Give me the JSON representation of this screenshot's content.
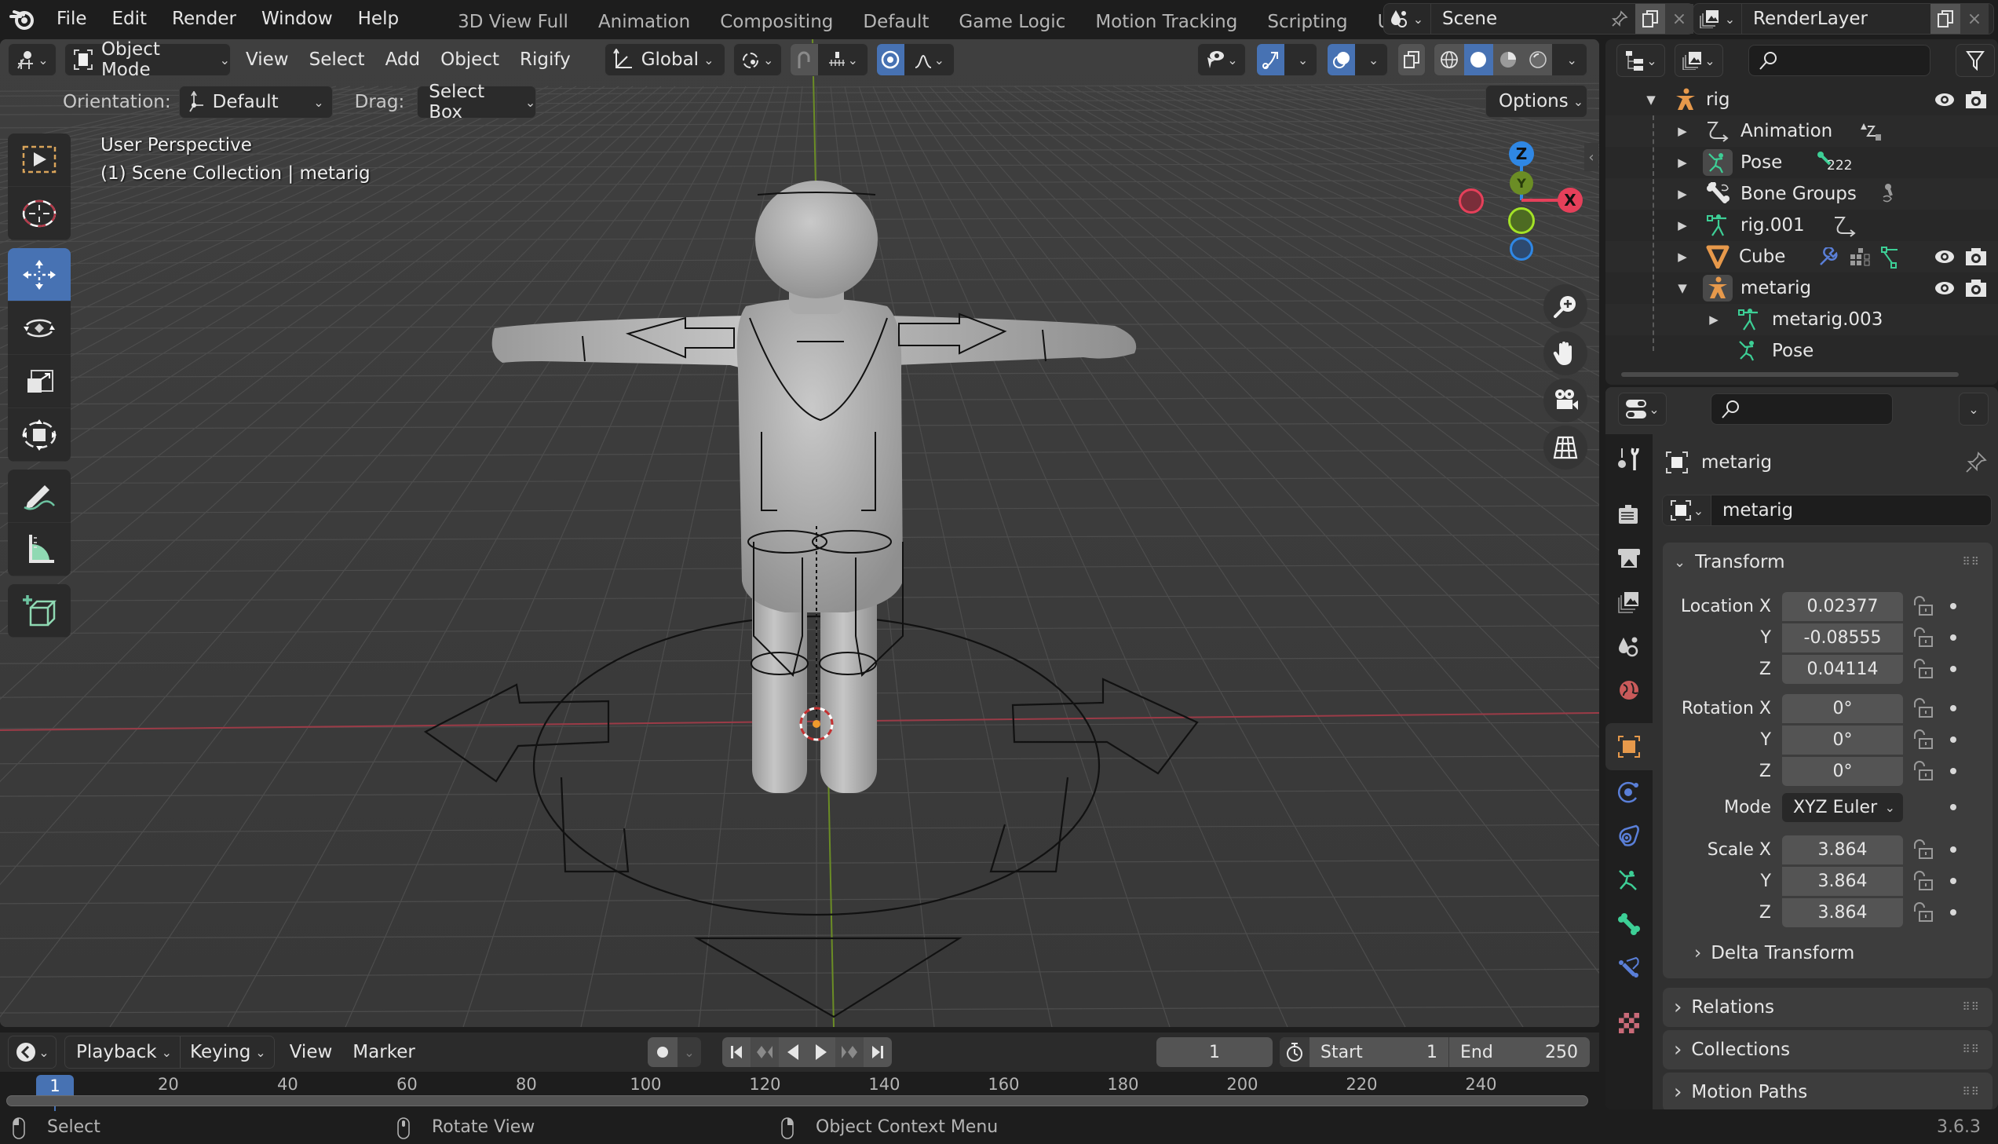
{
  "app": {
    "menus": [
      "File",
      "Edit",
      "Render",
      "Window",
      "Help"
    ],
    "workspaces": [
      "3D View Full",
      "Animation",
      "Compositing",
      "Default",
      "Game Logic",
      "Motion Tracking",
      "Scripting",
      "UV Editi"
    ],
    "scene": "Scene",
    "view_layer": "RenderLayer",
    "version": "3.6.3"
  },
  "viewport": {
    "mode": "Object Mode",
    "menus": [
      "View",
      "Select",
      "Add",
      "Object",
      "Rigify"
    ],
    "transform_orientation": "Global",
    "orientation_label": "Orientation:",
    "orientation_value": "Default",
    "drag_label": "Drag:",
    "drag_value": "Select Box",
    "options_label": "Options",
    "overlay_line1": "User Perspective",
    "overlay_line2": "(1) Scene Collection | metarig",
    "gizmo": {
      "x": "X",
      "y": "Y",
      "z": "Z"
    },
    "colors": {
      "x": "#e5405a",
      "y": "#8bc32a",
      "z": "#2f87e4",
      "accent": "#4772b3"
    }
  },
  "toolbar": {
    "tools": [
      "select-box",
      "cursor",
      "move",
      "rotate",
      "scale",
      "transform",
      "annotate",
      "measure",
      "add-cube"
    ],
    "active": "move"
  },
  "timeline": {
    "menus": [
      "Playback",
      "Keying",
      "View",
      "Marker"
    ],
    "current_frame": "1",
    "start_label": "Start",
    "start": "1",
    "end_label": "End",
    "end": "250",
    "ticks": [
      "20",
      "40",
      "60",
      "80",
      "100",
      "120",
      "140",
      "160",
      "180",
      "200",
      "220",
      "240"
    ],
    "playhead": "1"
  },
  "statusbar": {
    "left": "Select",
    "middle": "Rotate View",
    "right": "Object Context Menu"
  },
  "outliner": {
    "rows": [
      {
        "label": "rig",
        "depth": 0,
        "expanded": true,
        "icon": "armature-icon"
      },
      {
        "label": "Animation",
        "depth": 1,
        "icon": "animation-icon"
      },
      {
        "label": "Pose",
        "depth": 1,
        "icon": "pose-icon",
        "badge": "222"
      },
      {
        "label": "Bone Groups",
        "depth": 1,
        "icon": "bone-groups-icon"
      },
      {
        "label": "rig.001",
        "depth": 1,
        "icon": "armature-data-icon"
      },
      {
        "label": "Cube",
        "depth": 1,
        "icon": "mesh-icon"
      },
      {
        "label": "metarig",
        "depth": 1,
        "expanded": true,
        "icon": "armature-icon"
      },
      {
        "label": "metarig.003",
        "depth": 2,
        "icon": "armature-data-icon"
      },
      {
        "label": "Pose",
        "depth": 2,
        "icon": "pose-icon"
      }
    ]
  },
  "properties": {
    "object_name": "metarig",
    "datablock_name": "metarig",
    "transform": {
      "title": "Transform",
      "location_label": "Location X",
      "location": [
        "0.02377",
        "-0.08555",
        "0.04114"
      ],
      "rotation_label": "Rotation X",
      "rotation": [
        "0°",
        "0°",
        "0°"
      ],
      "mode_label": "Mode",
      "mode": "XYZ Euler",
      "scale_label": "Scale X",
      "scale": [
        "3.864",
        "3.864",
        "3.864"
      ],
      "axis_y": "Y",
      "axis_z": "Z",
      "delta": "Delta Transform"
    },
    "panels": [
      "Relations",
      "Collections",
      "Motion Paths"
    ]
  }
}
